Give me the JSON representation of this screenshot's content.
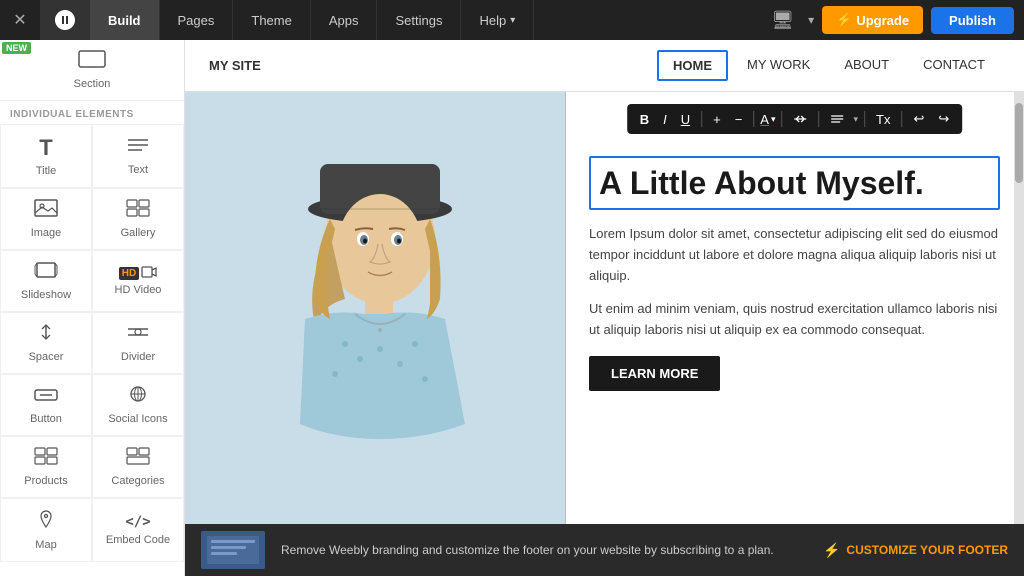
{
  "topNav": {
    "tabs": [
      {
        "id": "build",
        "label": "Build",
        "active": true
      },
      {
        "id": "pages",
        "label": "Pages",
        "active": false
      },
      {
        "id": "theme",
        "label": "Theme",
        "active": false
      },
      {
        "id": "apps",
        "label": "Apps",
        "active": false
      },
      {
        "id": "settings",
        "label": "Settings",
        "active": false
      },
      {
        "id": "help",
        "label": "Help",
        "active": false
      }
    ],
    "upgradeLabel": "Upgrade",
    "publishLabel": "Publish"
  },
  "sidebar": {
    "newBadge": "NEW",
    "sectionLabel": "Section",
    "individualElementsLabel": "INDIVIDUAL ELEMENTS",
    "items": [
      {
        "id": "title",
        "label": "Title",
        "icon": "T"
      },
      {
        "id": "text",
        "label": "Text",
        "icon": "≡"
      },
      {
        "id": "image",
        "label": "Image",
        "icon": "🖼"
      },
      {
        "id": "gallery",
        "label": "Gallery",
        "icon": "⊞"
      },
      {
        "id": "slideshow",
        "label": "Slideshow",
        "icon": "▤"
      },
      {
        "id": "hd-video",
        "label": "HD Video",
        "icon": "▶"
      },
      {
        "id": "spacer",
        "label": "Spacer",
        "icon": "↕"
      },
      {
        "id": "divider",
        "label": "Divider",
        "icon": "÷"
      },
      {
        "id": "button",
        "label": "Button",
        "icon": "▬"
      },
      {
        "id": "social-icons",
        "label": "Social Icons",
        "icon": "⊕"
      },
      {
        "id": "products",
        "label": "Products",
        "icon": "⊞"
      },
      {
        "id": "categories",
        "label": "Categories",
        "icon": "⊟"
      },
      {
        "id": "map",
        "label": "Map",
        "icon": "📍"
      },
      {
        "id": "embed-code",
        "label": "Embed Code",
        "icon": "</>"
      }
    ]
  },
  "siteHeader": {
    "logo": "MY SITE",
    "navItems": [
      {
        "id": "home",
        "label": "HOME",
        "active": true
      },
      {
        "id": "my-work",
        "label": "MY WORK",
        "active": false
      },
      {
        "id": "about",
        "label": "ABOUT",
        "active": false
      },
      {
        "id": "contact",
        "label": "CONTACT",
        "active": false
      }
    ]
  },
  "content": {
    "heading": "A Little About Myself.",
    "body1": "Lorem Ipsum dolor sit amet, consectetur adipiscing elit sed do eiusmod tempor inciddunt ut labore et dolore magna aliqua aliquip laboris nisi ut aliquip.",
    "body2": "Ut enim ad minim veniam, quis nostrud exercitation ullamco laboris nisi ut aliquip laboris nisi ut aliquip ex ea commodo consequat.",
    "learnMoreLabel": "LEARN MORE"
  },
  "footer": {
    "message": "Remove Weebly branding and customize the footer on your website by subscribing to a plan.",
    "ctaLabel": "CUSTOMIZE YOUR FOOTER"
  },
  "toolbar": {
    "bold": "B",
    "italic": "I",
    "underline": "U",
    "addIcon": "+",
    "removeIcon": "−",
    "colorIcon": "A",
    "linkIcon": "🔗",
    "alignIcon": "≡",
    "clearIcon": "Tx",
    "undoIcon": "↩",
    "redoIcon": "↪"
  }
}
